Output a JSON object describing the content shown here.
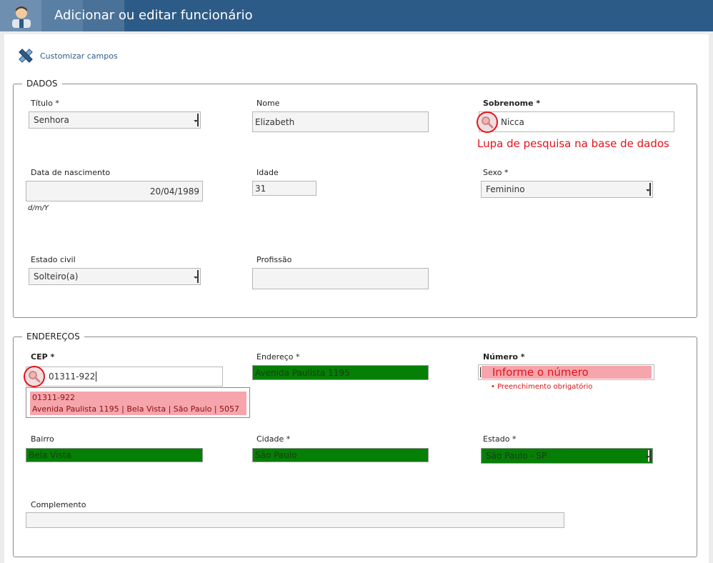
{
  "header": {
    "title": "Adicionar ou editar funcionário"
  },
  "toolbar": {
    "customize_label": "Customizar campos"
  },
  "dados": {
    "legend": "DADOS",
    "titulo": {
      "label": "Título *",
      "value": "Senhora"
    },
    "nome": {
      "label": "Nome",
      "value": "Elizabeth"
    },
    "sobrenome": {
      "label": "Sobrenome *",
      "value": "Nicca"
    },
    "annotation": "Lupa de pesquisa na base de dados",
    "nascimento": {
      "label": "Data de nascimento",
      "value": "20/04/1989",
      "hint": "d/m/Y"
    },
    "idade": {
      "label": "Idade",
      "value": "31"
    },
    "sexo": {
      "label": "Sexo *",
      "value": "Feminino"
    },
    "estado_civil": {
      "label": "Estado civil",
      "value": "Solteiro(a)"
    },
    "profissao": {
      "label": "Profissão",
      "value": ""
    }
  },
  "enderecos": {
    "legend": "ENDEREÇOS",
    "cep": {
      "label": "CEP *",
      "value": "01311-922"
    },
    "suggestion": {
      "line1": "01311-922",
      "line2": "Avenida Paulista 1195 | Bela Vista | São Paulo | 5057"
    },
    "endereco": {
      "label": "Endereço *",
      "value": "Avenida Paulista 1195"
    },
    "numero": {
      "label": "Número *",
      "placeholder": "Informe o número",
      "error": "• Preenchimento obrigatório"
    },
    "bairro": {
      "label": "Bairro",
      "value": "Bela Vista"
    },
    "cidade": {
      "label": "Cidade *",
      "value": "São Paulo"
    },
    "estado": {
      "label": "Estado *",
      "value": "São Paulo - SP"
    },
    "complemento": {
      "label": "Complemento",
      "value": ""
    }
  },
  "colors": {
    "header": "#2d5b87",
    "highlight_green": "#057f05",
    "highlight_pink": "#f6a5ac",
    "annotation_red": "#e3131e"
  },
  "icons": {
    "avatar": "user-avatar-icon",
    "customize": "pencil-ruler-icon",
    "search": "magnifier-icon"
  }
}
